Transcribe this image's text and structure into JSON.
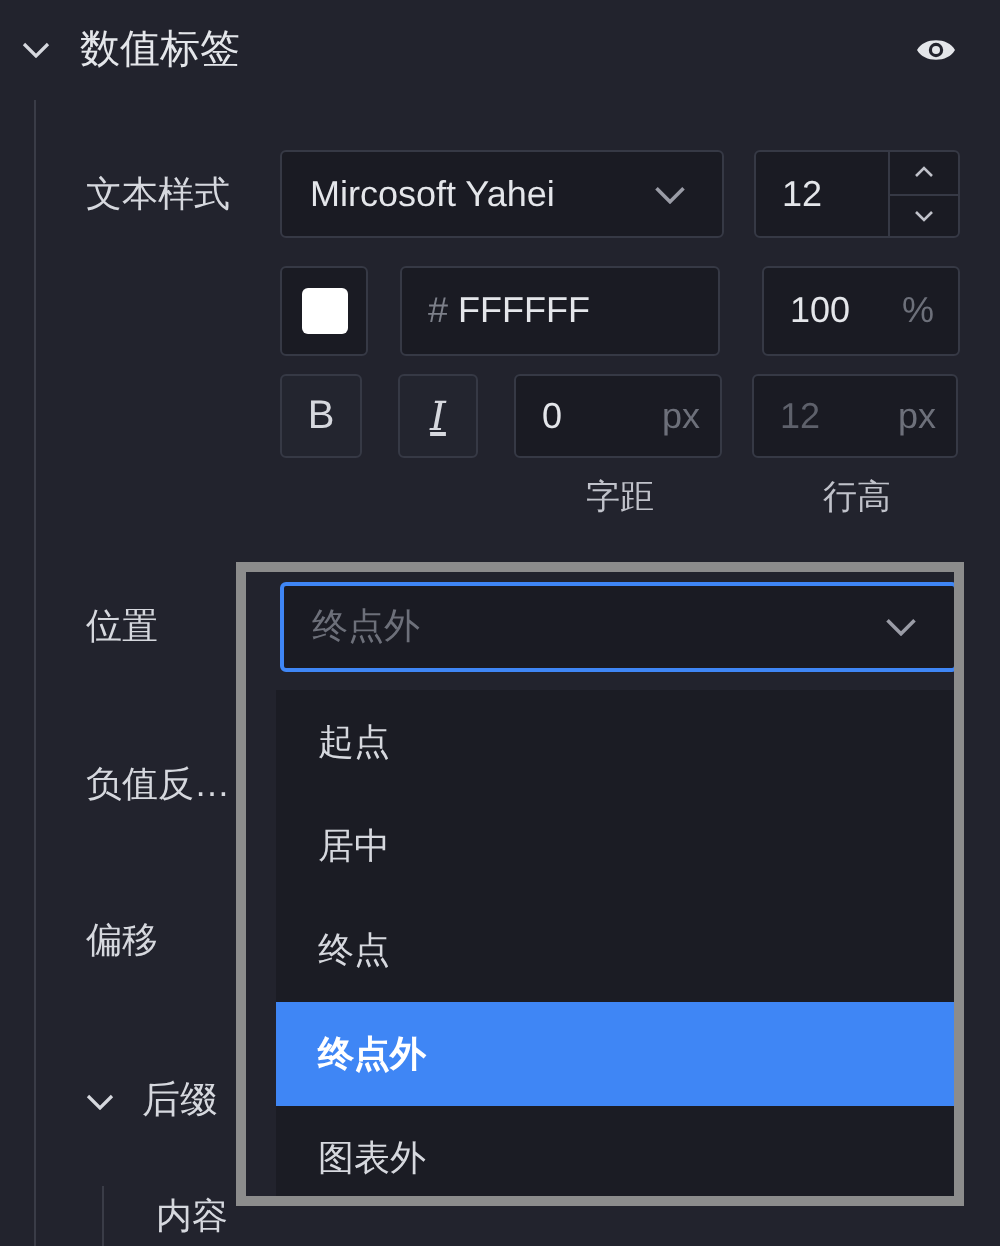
{
  "section": {
    "title": "数值标签",
    "expanded": true,
    "visible": true
  },
  "text_style": {
    "label": "文本样式",
    "font": "Mircosoft Yahei",
    "size": "12",
    "hex_prefix": "#",
    "hex": "FFFFFF",
    "opacity": "100",
    "opacity_unit": "%",
    "bold": false,
    "italic": false,
    "bold_label": "B",
    "italic_label": "I",
    "letter_spacing": "0",
    "letter_spacing_unit": "px",
    "line_height_placeholder": "12",
    "line_height_unit": "px",
    "letter_spacing_caption": "字距",
    "line_height_caption": "行高"
  },
  "position": {
    "label": "位置",
    "placeholder": "终点外",
    "focused": true,
    "options": [
      {
        "label": "起点",
        "selected": false
      },
      {
        "label": "居中",
        "selected": false
      },
      {
        "label": "终点",
        "selected": false
      },
      {
        "label": "终点外",
        "selected": true
      },
      {
        "label": "图表外",
        "selected": false
      }
    ]
  },
  "rows": [
    {
      "label": "负值反…"
    },
    {
      "label": "偏移"
    }
  ],
  "suffix": {
    "title": "后缀",
    "expanded": true,
    "rows": [
      {
        "label": "内容"
      }
    ]
  }
}
